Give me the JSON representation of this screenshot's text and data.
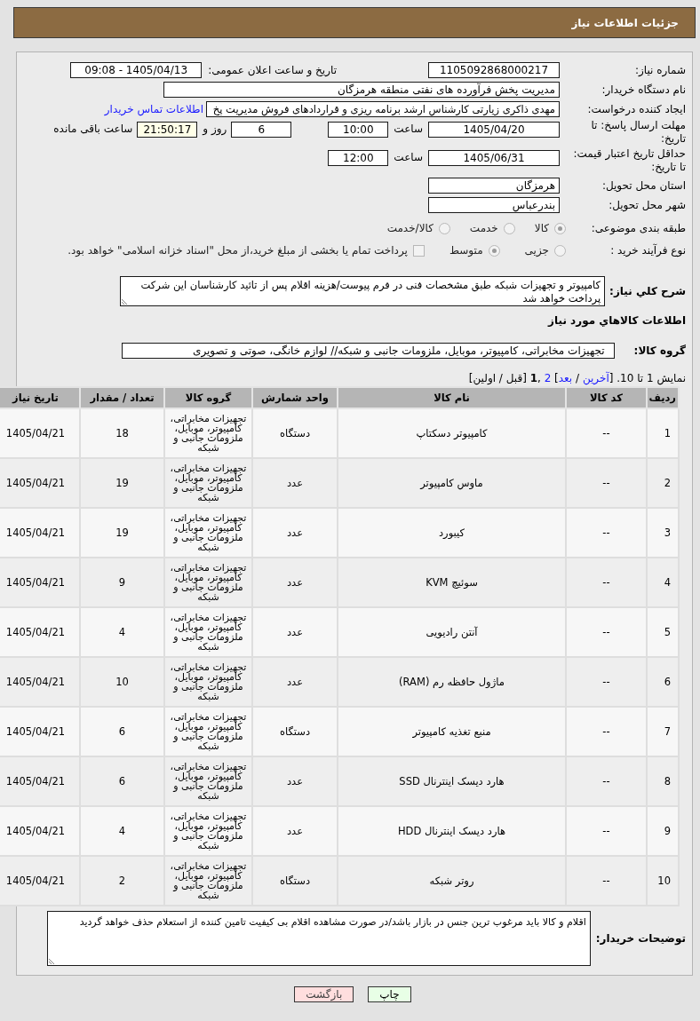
{
  "header": {
    "title": "جزئیات اطلاعات نیاز"
  },
  "details": {
    "need_number": {
      "label": "شماره نیاز:",
      "value": "1105092868000217"
    },
    "announce_datetime": {
      "label": "تاریخ و ساعت اعلان عمومی:",
      "value": "1405/04/13 - 09:08"
    },
    "buyer_org": {
      "label": "نام دستگاه خریدار:",
      "value": "مدیریت پخش فرآورده های نفتی منطقه هرمزگان"
    },
    "requester": {
      "label": "ایجاد کننده درخواست:",
      "value": "مهدی ذاکری زیارتی کارشناس ارشد برنامه ریزی و قراردادهای فروش مدیریت پخ",
      "contact_link": "اطلاعات تماس خریدار"
    },
    "response_deadline": {
      "label": "مهلت ارسال پاسخ: تا تاریخ:",
      "date": "1405/04/20",
      "time_label": "ساعت",
      "time": "10:00",
      "days": "6",
      "days_label": "روز و",
      "remaining": "21:50:17",
      "remaining_label": "ساعت باقی مانده"
    },
    "price_validity": {
      "label": "حداقل تاریخ اعتبار قیمت: تا تاریخ:",
      "date": "1405/06/31",
      "time_label": "ساعت",
      "time": "12:00"
    },
    "province": {
      "label": "استان محل تحویل:",
      "value": "هرمزگان"
    },
    "city": {
      "label": "شهر محل تحویل:",
      "value": "بندرعباس"
    },
    "category": {
      "label": "طبقه بندی موضوعی:",
      "options": [
        {
          "label": "کالا",
          "selected": true
        },
        {
          "label": "خدمت",
          "selected": false
        },
        {
          "label": "کالا/خدمت",
          "selected": false
        }
      ]
    },
    "purchase_type": {
      "label": "نوع فرآیند خرید :",
      "options": [
        {
          "label": "جزیی",
          "selected": false
        },
        {
          "label": "متوسط",
          "selected": true
        }
      ],
      "treasury_option": {
        "label": "پرداخت تمام یا بخشی از مبلغ خرید،از محل \"اسناد خزانه اسلامی\" خواهد بود.",
        "checked": false
      }
    }
  },
  "description": {
    "label": "شرح كلي نیاز:",
    "value": "کامپیوتر و تجهیزات شبکه طبق مشخصات فنی در فرم پیوست/هزینه اقلام پس از تائید کارشناسان این شرکت پرداخت خواهد شد"
  },
  "goods": {
    "title": "اطلاعات كالاهاي مورد نیاز",
    "group_label": "گروه کالا:",
    "group_value": "تجهیزات مخابراتی، کامپیوتر، موبایل، ملزومات جانبی و شبکه// لوازم خانگی، صوتی و تصویری",
    "pagination": [
      {
        "kind": "text",
        "text": "نمایش 1 تا 10. ["
      },
      {
        "kind": "link",
        "text": "آخرین"
      },
      {
        "kind": "text",
        "text": " / "
      },
      {
        "kind": "link",
        "text": "بعد"
      },
      {
        "kind": "text",
        "text": "] "
      },
      {
        "kind": "link",
        "text": "2"
      },
      {
        "kind": "text",
        "text": " ,"
      },
      {
        "kind": "current",
        "text": "1"
      },
      {
        "kind": "text",
        "text": " [قبل / اولین]"
      }
    ],
    "table": {
      "columns": [
        "ردیف",
        "کد کالا",
        "نام کالا",
        "واحد شمارش",
        "گروه کالا",
        "تعداد / مقدار",
        "تاریخ نیاز"
      ],
      "rows": [
        {
          "row_no": "1",
          "code": "--",
          "name": "کامپیوتر دسکتاپ",
          "unit": "دستگاه",
          "group": "تجهیزات مخابراتی، کامپیوتر، موبایل، ملزومات جانبی و شبکه",
          "quantity": "18",
          "need_date": "1405/04/21"
        },
        {
          "row_no": "2",
          "code": "--",
          "name": "ماوس کامپیوتر",
          "unit": "عدد",
          "group": "تجهیزات مخابراتی، کامپیوتر، موبایل، ملزومات جانبی و شبکه",
          "quantity": "19",
          "need_date": "1405/04/21"
        },
        {
          "row_no": "3",
          "code": "--",
          "name": "کیبورد",
          "unit": "عدد",
          "group": "تجهیزات مخابراتی، کامپیوتر، موبایل، ملزومات جانبی و شبکه",
          "quantity": "19",
          "need_date": "1405/04/21"
        },
        {
          "row_no": "4",
          "code": "--",
          "name": "سوئیچ KVM",
          "unit": "عدد",
          "group": "تجهیزات مخابراتی، کامپیوتر، موبایل، ملزومات جانبی و شبکه",
          "quantity": "9",
          "need_date": "1405/04/21"
        },
        {
          "row_no": "5",
          "code": "--",
          "name": "آنتن رادیویی",
          "unit": "عدد",
          "group": "تجهیزات مخابراتی، کامپیوتر، موبایل، ملزومات جانبی و شبکه",
          "quantity": "4",
          "need_date": "1405/04/21"
        },
        {
          "row_no": "6",
          "code": "--",
          "name": "ماژول حافظه رم (RAM)",
          "unit": "عدد",
          "group": "تجهیزات مخابراتی، کامپیوتر، موبایل، ملزومات جانبی و شبکه",
          "quantity": "10",
          "need_date": "1405/04/21"
        },
        {
          "row_no": "7",
          "code": "--",
          "name": "منبع تغذیه کامپیوتر",
          "unit": "دستگاه",
          "group": "تجهیزات مخابراتی، کامپیوتر، موبایل، ملزومات جانبی و شبکه",
          "quantity": "6",
          "need_date": "1405/04/21"
        },
        {
          "row_no": "8",
          "code": "--",
          "name": "هارد دیسک اینترنال SSD",
          "unit": "عدد",
          "group": "تجهیزات مخابراتی، کامپیوتر، موبایل، ملزومات جانبی و شبکه",
          "quantity": "6",
          "need_date": "1405/04/21"
        },
        {
          "row_no": "9",
          "code": "--",
          "name": "هارد دیسک اینترنال HDD",
          "unit": "عدد",
          "group": "تجهیزات مخابراتی، کامپیوتر، موبایل، ملزومات جانبی و شبکه",
          "quantity": "4",
          "need_date": "1405/04/21"
        },
        {
          "row_no": "10",
          "code": "--",
          "name": "روتر شبکه",
          "unit": "دستگاه",
          "group": "تجهیزات مخابراتی، کامپیوتر، موبایل، ملزومات جانبی و شبکه",
          "quantity": "2",
          "need_date": "1405/04/21"
        }
      ]
    }
  },
  "buyer_notes": {
    "label": "توضیحات خریدار:",
    "value": "اقلام و کالا باید مرغوب ترین جنس در بازار باشد/در صورت مشاهده اقلام بی کیفیت تامین کننده از استعلام حذف خواهد گردید"
  },
  "buttons": [
    {
      "kind": "print",
      "label": "چاپ"
    },
    {
      "kind": "back",
      "label": "بازگشت"
    }
  ]
}
